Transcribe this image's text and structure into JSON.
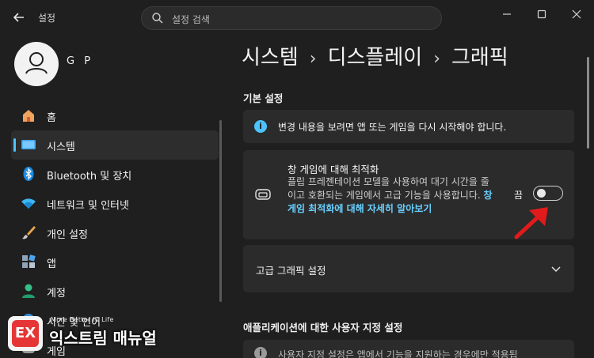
{
  "window": {
    "app_title": "설정",
    "search_placeholder": "설정 검색"
  },
  "profile": {
    "name": "G P"
  },
  "sidebar": {
    "items": [
      {
        "label": "홈",
        "icon": "home-icon",
        "selected": false
      },
      {
        "label": "시스템",
        "icon": "system-icon",
        "selected": true
      },
      {
        "label": "Bluetooth 및 장치",
        "icon": "bluetooth-icon",
        "selected": false
      },
      {
        "label": "네트워크 및 인터넷",
        "icon": "wifi-icon",
        "selected": false
      },
      {
        "label": "개인 설정",
        "icon": "brush-icon",
        "selected": false
      },
      {
        "label": "앱",
        "icon": "apps-icon",
        "selected": false
      },
      {
        "label": "계정",
        "icon": "account-icon",
        "selected": false
      },
      {
        "label": "시간 및 언어",
        "icon": "time-language-icon",
        "selected": false
      },
      {
        "label": "게임",
        "icon": "gaming-icon",
        "selected": false
      }
    ]
  },
  "breadcrumb": {
    "part1": "시스템",
    "part2": "디스플레이",
    "part3": "그래픽",
    "separator": "›"
  },
  "basic_settings": {
    "heading": "기본 설정",
    "info_text": "변경 내용을 보려면 앱 또는 게임을 다시 시작해야 합니다.",
    "windowed_opt": {
      "title": "창 게임에 대해 최적화",
      "description": "플립 프레젠테이션 모델을 사용하여 대기 시간을 줄이고 호환되는 게임에서 고급 기능을 사용합니다.",
      "link": "창 게임 최적화에 대해 자세히 알아보기",
      "toggle_label": "끔",
      "toggle_on": false
    },
    "advanced_label": "고급 그래픽 설정"
  },
  "custom_settings": {
    "heading": "애플리케이션에 대한 사용자 지정 설정",
    "partial_text": "사용자 지정 설정은 앱에서 기능을 지원하는 경우에만 적용됩"
  },
  "watermark": {
    "tagline": "More Better IT Life",
    "brand": "익스트림 매뉴얼",
    "logo_letter": "EX"
  },
  "colors": {
    "accent": "#4cc2ff",
    "link": "#68cfff",
    "arrow": "#e11b1b"
  }
}
